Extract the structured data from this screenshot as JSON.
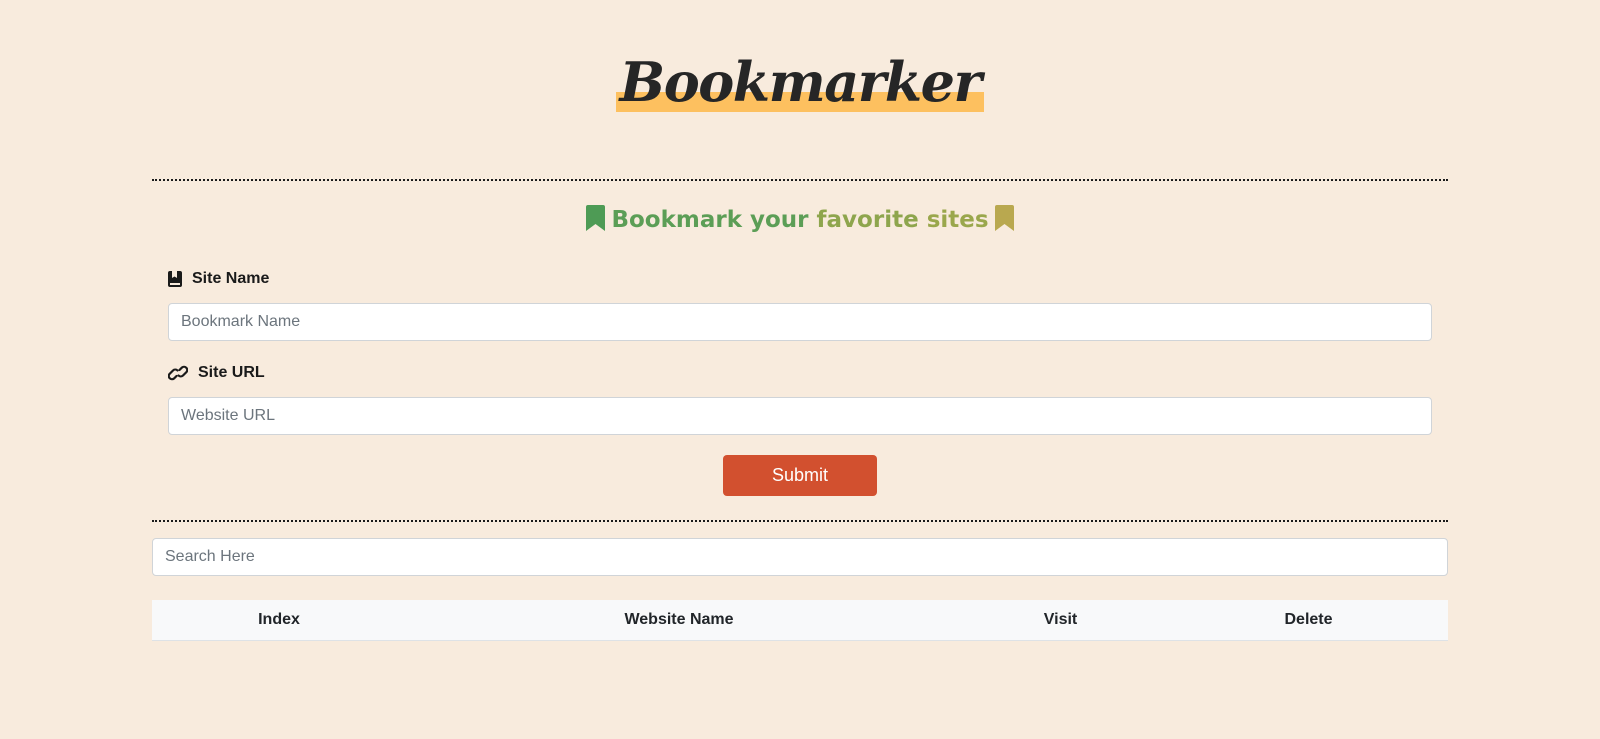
{
  "header": {
    "title": "Bookmarker",
    "highlight_color": "#fdc05f"
  },
  "form": {
    "heading": {
      "part1": "Bookmark your",
      "part2": "favorite",
      "part3": "sites",
      "left_icon": "bookmark-icon",
      "right_icon": "bookmark-icon"
    },
    "site_name": {
      "label": "Site Name",
      "icon": "book-bookmark-icon",
      "placeholder": "Bookmark Name",
      "value": ""
    },
    "site_url": {
      "label": "Site URL",
      "icon": "link-icon",
      "placeholder": "Website URL",
      "value": ""
    },
    "submit_label": "Submit",
    "submit_color": "#d2502f"
  },
  "search": {
    "placeholder": "Search Here",
    "value": ""
  },
  "table": {
    "columns": [
      "Index",
      "Website Name",
      "Visit",
      "Delete"
    ],
    "rows": []
  },
  "colors": {
    "background": "#f8ebdd",
    "accent_green": "#5c9e56",
    "accent_olive": "#9aa74c"
  }
}
